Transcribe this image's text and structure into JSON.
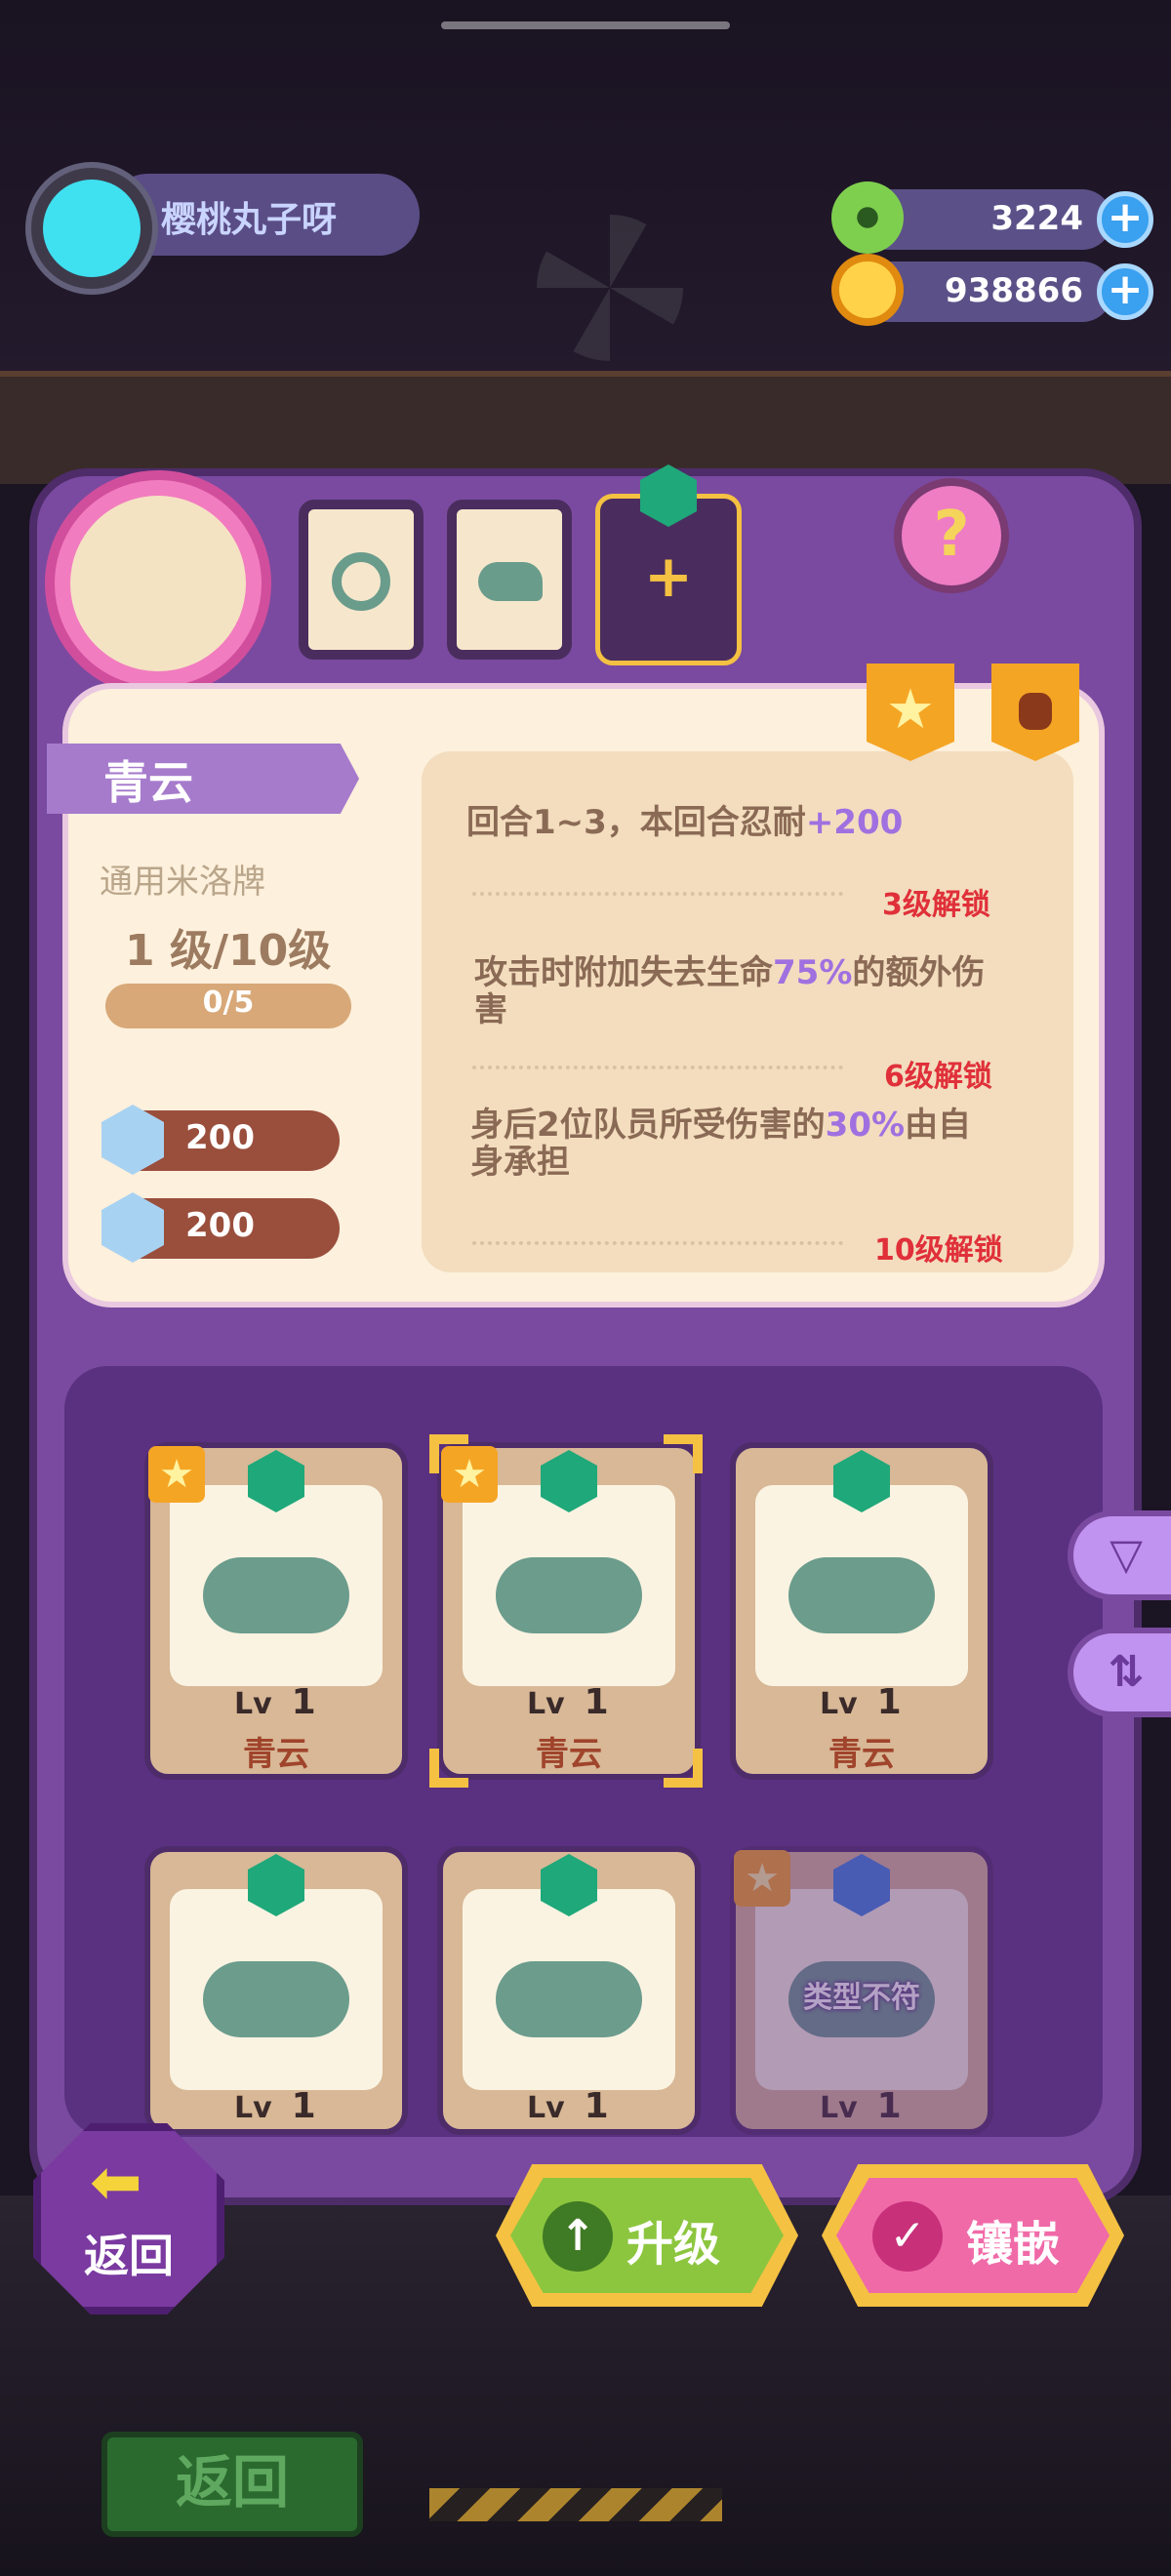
{
  "player": {
    "name": "樱桃丸子呀"
  },
  "currencies": [
    {
      "value": "3224",
      "icon": "donut-icon",
      "color": "#7fcf4f"
    },
    {
      "value": "938866",
      "icon": "planet-coin-icon",
      "color": "#f5a524"
    }
  ],
  "equip_slots": [
    {
      "icon": "spiral-icon"
    },
    {
      "icon": "bird-icon"
    },
    {
      "label": "+",
      "icon": "add-slot-icon"
    }
  ],
  "help": {
    "label": "?"
  },
  "card_detail": {
    "title": "青云",
    "type": "通用米洛牌",
    "level_num": "1",
    "level_text": "级/10级",
    "progress": "0/5",
    "progress_fraction": 0,
    "stats": [
      "200",
      "200"
    ],
    "abilities": [
      {
        "pre": "回合1~3，本回合忍耐",
        "hl": "+200",
        "post": "",
        "unlock": "3级解锁"
      },
      {
        "pre": "攻击时附加失去生命",
        "hl": "75%",
        "post": "的额外伤害",
        "unlock": "6级解锁"
      },
      {
        "pre": "身后2位队员所受伤害的",
        "hl": "30%",
        "post": "由自身承担",
        "unlock": "10级解锁"
      }
    ]
  },
  "collection": [
    {
      "name": "青云",
      "lv_label": "Lv",
      "lv": "1",
      "star": true,
      "gem": "green",
      "selected": false
    },
    {
      "name": "青云",
      "lv_label": "Lv",
      "lv": "1",
      "star": true,
      "gem": "green",
      "selected": true
    },
    {
      "name": "青云",
      "lv_label": "Lv",
      "lv": "1",
      "star": false,
      "gem": "green",
      "selected": false
    },
    {
      "name": "",
      "lv_label": "Lv",
      "lv": "1",
      "star": false,
      "gem": "green",
      "selected": false
    },
    {
      "name": "",
      "lv_label": "Lv",
      "lv": "1",
      "star": false,
      "gem": "green",
      "selected": false
    },
    {
      "name": "",
      "lv_label": "Lv",
      "lv": "1",
      "star": true,
      "gem": "blue",
      "selected": false,
      "overlay": "类型不符"
    }
  ],
  "buttons": {
    "back": "返回",
    "upgrade": "升级",
    "inlay": "镶嵌",
    "bottom_back": "返回"
  },
  "colors": {
    "panel": "#7a4aa0",
    "accent": "#f4c142",
    "upgrade": "#8cc63f",
    "inlay": "#f06aa8"
  }
}
